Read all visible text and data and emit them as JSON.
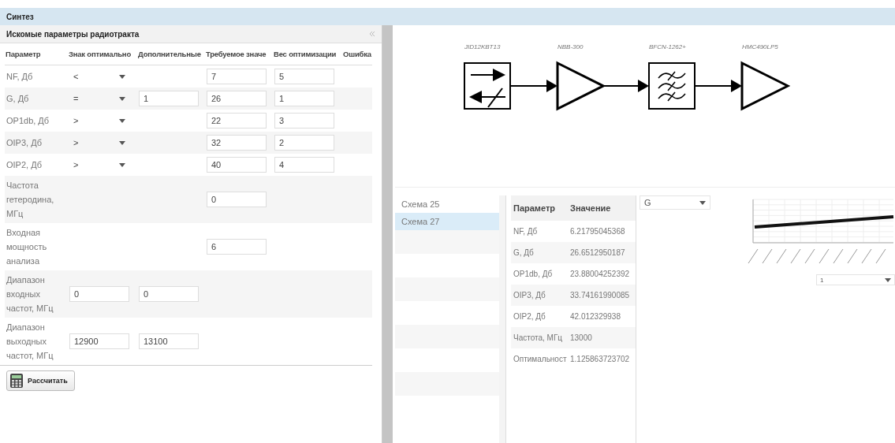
{
  "window": {
    "title": "Синтез"
  },
  "params_panel": {
    "title": "Искомые параметры радиотракта",
    "columns": [
      "Параметр",
      "Знак оптимально",
      "Дополнительные",
      "Требуемое значе",
      "Вес оптимизации",
      "Ошибка"
    ],
    "rows": [
      {
        "kind": "criterion",
        "label": "NF, Дб",
        "sign": "<",
        "required": "7",
        "weight": "5"
      },
      {
        "kind": "criterion",
        "label": "G, Дб",
        "sign": "=",
        "extra": "1",
        "required": "26",
        "weight": "1"
      },
      {
        "kind": "criterion",
        "label": "OP1db, Дб",
        "sign": ">",
        "required": "22",
        "weight": "3"
      },
      {
        "kind": "criterion",
        "label": "OIP3, Дб",
        "sign": ">",
        "required": "32",
        "weight": "2"
      },
      {
        "kind": "criterion",
        "label": "OIP2, Дб",
        "sign": ">",
        "required": "40",
        "weight": "4"
      },
      {
        "kind": "value",
        "label": "Частота гетеродина, МГц",
        "required": "0"
      },
      {
        "kind": "value",
        "label": "Входная мощность анализа",
        "required": "6"
      },
      {
        "kind": "range",
        "label": "Диапазон входных частот, МГц",
        "from": "0",
        "to": "0"
      },
      {
        "kind": "range",
        "label": "Диапазон выходных частот, МГц",
        "from": "12900",
        "to": "13100"
      }
    ],
    "calculate_button": "Рассчитать"
  },
  "diagram": {
    "blocks": [
      {
        "kind": "isolator",
        "label": "JID12KBT13"
      },
      {
        "kind": "amplifier",
        "label": "NBB-300"
      },
      {
        "kind": "filter",
        "label": "BFCN-1262+"
      },
      {
        "kind": "amplifier",
        "label": "HMC490LP5"
      }
    ]
  },
  "schemes": [
    {
      "name": "Схема 25",
      "selected": false
    },
    {
      "name": "Схема 27",
      "selected": true
    }
  ],
  "results": {
    "columns": [
      "Параметр",
      "Значение"
    ],
    "rows": [
      [
        "NF, Дб",
        "6.21795045368"
      ],
      [
        "G, Дб",
        "26.6512950187"
      ],
      [
        "OP1db, Дб",
        "23.88004252392"
      ],
      [
        "OIP3, Дб",
        "33.74161990085"
      ],
      [
        "OIP2, Дб",
        "42.012329938"
      ],
      [
        "Частота, МГц",
        "13000"
      ],
      [
        "Оптимальност",
        "1.125863723702"
      ]
    ]
  },
  "parameter_select": {
    "value": "G"
  },
  "chart_select": {
    "value": "1"
  }
}
